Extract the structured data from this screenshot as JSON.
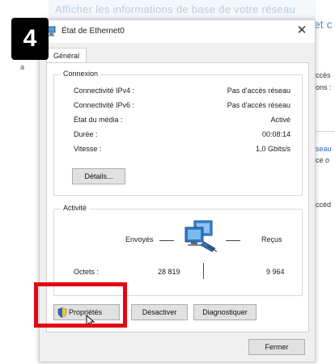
{
  "step": {
    "number": "4"
  },
  "background": {
    "left_marker": "a",
    "top_fragment": "Afficher les informations de base de votre réseau",
    "right_title": "et c",
    "right_lines": [
      "ccès",
      "ons :",
      "seau",
      "ce o",
      "ccéd"
    ]
  },
  "dialog": {
    "title": "État de Ethernet0",
    "close_glyph": "✕",
    "tab_label": "Général",
    "connection": {
      "group_label": "Connexion",
      "rows": [
        {
          "label": "Connectivité IPv4 :",
          "value": "Pas d'accès réseau"
        },
        {
          "label": "Connectivité IPv6 :",
          "value": "Pas d'accès réseau"
        },
        {
          "label": "État du média :",
          "value": "Activé"
        },
        {
          "label": "Durée :",
          "value": "00:08:14"
        },
        {
          "label": "Vitesse :",
          "value": "1,0 Gbits/s"
        }
      ],
      "details_button": "Détails..."
    },
    "activity": {
      "group_label": "Activité",
      "sent_label": "Envoyés",
      "received_label": "Reçus",
      "octets_label": "Octets :",
      "sent_value": "28 819",
      "received_value": "9 964"
    },
    "buttons": {
      "properties": "Propriétés",
      "disable": "Désactiver",
      "diagnose": "Diagnostiquer",
      "close": "Fermer"
    }
  },
  "icons": {
    "title": "ethernet-adapter-icon",
    "network": "network-computers-icon",
    "shield": "uac-shield-icon",
    "cursor": "mouse-pointer-icon"
  },
  "colors": {
    "highlight": "#e30613",
    "badge_bg": "#000000",
    "dialog_bg": "#f0f0f0"
  }
}
